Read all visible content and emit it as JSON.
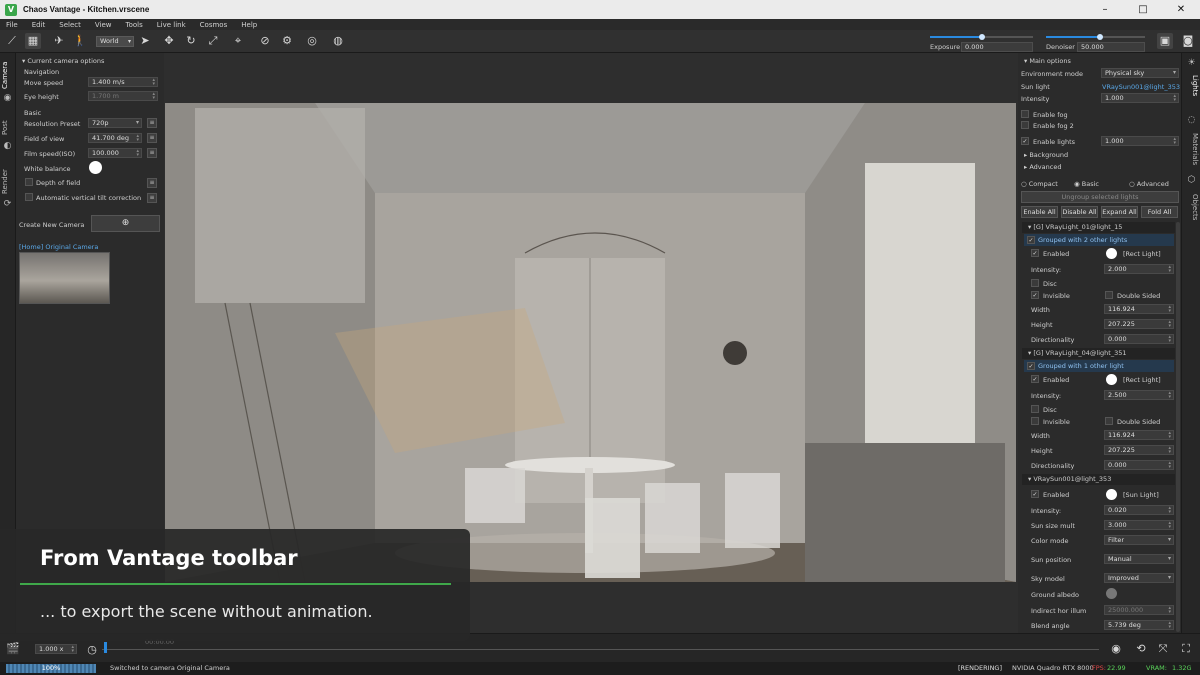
{
  "app": {
    "title": "Chaos Vantage - Kitchen.vrscene",
    "logo": "V"
  },
  "window_buttons": [
    "–",
    "□",
    "✕"
  ],
  "menu": [
    "File",
    "Edit",
    "Select",
    "View",
    "Tools",
    "Live link",
    "Cosmos",
    "Help"
  ],
  "toolbar": {
    "space_select": "World",
    "exposure": {
      "label": "Exposure",
      "value": "0.000",
      "level": 0.5
    },
    "denoiser": {
      "label": "Denoiser",
      "value": "50.000",
      "level": 0.55
    }
  },
  "left_tabs": {
    "camera": "Camera",
    "post": "Post",
    "render": "Render"
  },
  "camera_panel": {
    "header": "Current camera options",
    "navigation": "Navigation",
    "move_speed_label": "Move speed",
    "move_speed": "1.400 m/s",
    "eye_height_label": "Eye height",
    "eye_height": "1.700 m",
    "basic": "Basic",
    "resolution_label": "Resolution Preset",
    "resolution": "720p",
    "fov_label": "Field of view",
    "fov": "41.700 deg",
    "film_label": "Film speed(ISO)",
    "film": "100.000",
    "white_balance_label": "White balance",
    "depth_label": "Depth of field",
    "tilt_label": "Automatic vertical tilt correction",
    "create_camera": "Create New Camera",
    "camera_name": "[Home] Original Camera"
  },
  "right_tabs": {
    "lights": "Lights",
    "materials": "Materials",
    "objects": "Objects"
  },
  "lights_panel": {
    "header": "Main options",
    "env_mode_label": "Environment mode",
    "env_mode": "Physical sky",
    "sun_light_label": "Sun light",
    "sun_light": "VRaySun001@light_353",
    "intensity_label": "Intensity",
    "intensity": "1.000",
    "fog": "Enable fog",
    "fog2": "Enable fog 2",
    "enable_lights": "Enable lights",
    "enable_lights_value": "1.000",
    "background": "Background",
    "advanced": "Advanced",
    "modes": [
      "Compact",
      "Basic",
      "Advanced"
    ],
    "ungroup": "Ungroup selected lights",
    "actions": [
      "Enable All",
      "Disable All",
      "Expand All",
      "Fold All"
    ],
    "light1": {
      "name": "[G] VRayLight_01@light_15",
      "grouped": "Grouped with 2 other lights",
      "enabled": "Enabled",
      "type": "[Rect Light]",
      "intensity_label": "Intensity:",
      "intensity": "2.000",
      "disc": "Disc",
      "invisible": "Invisible",
      "double_sided": "Double Sided",
      "width_label": "Width",
      "width": "116.924",
      "height_label": "Height",
      "height": "207.225",
      "dir_label": "Directionality",
      "dir": "0.000"
    },
    "light2": {
      "name": "[G] VRayLight_04@light_351",
      "grouped": "Grouped with 1 other light",
      "enabled": "Enabled",
      "type": "[Rect Light]",
      "intensity_label": "Intensity:",
      "intensity": "2.500",
      "disc": "Disc",
      "invisible": "Invisible",
      "double_sided": "Double Sided",
      "width_label": "Width",
      "width": "116.924",
      "height_label": "Height",
      "height": "207.225",
      "dir_label": "Directionality",
      "dir": "0.000"
    },
    "sun": {
      "name": "VRaySun001@light_353",
      "enabled": "Enabled",
      "type": "[Sun Light]",
      "intensity_label": "Intensity:",
      "intensity": "0.020",
      "size_label": "Sun size mult",
      "size": "3.000",
      "color_mode_label": "Color mode",
      "color_mode": "Filter",
      "position_label": "Sun position",
      "position": "Manual",
      "sky_label": "Sky model",
      "sky": "Improved",
      "albedo_label": "Ground albedo",
      "indirect_label": "Indirect hor illum",
      "indirect": "25000.000",
      "blend_label": "Blend angle",
      "blend": "5.739 deg"
    }
  },
  "timeline": {
    "speed": "1.000 x",
    "time": "00:00.00"
  },
  "status": {
    "progress_text": "100%",
    "progress": 1.0,
    "message": "Switched to camera Original Camera",
    "rendering": "[RENDERING]",
    "gpu": "NVIDIA Quadro RTX 8000",
    "fps_label": "FPS:",
    "fps": "22.99",
    "vram_label": "VRAM:",
    "vram": "1.32G"
  },
  "overlay": {
    "heading": "From Vantage toolbar",
    "subtitle": "... to export the scene without animation."
  }
}
